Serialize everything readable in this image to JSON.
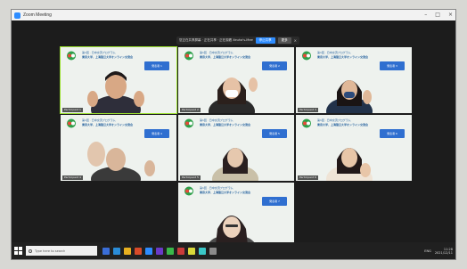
{
  "window": {
    "title": "Zoom Meeting",
    "controls": [
      "–",
      "□",
      "×"
    ]
  },
  "share_bar": {
    "text": "您正在共享屏幕 · 正在共享 · 正在观看 Xeuha's-Meeting 屏幕",
    "stop_label": "停止共享",
    "more_label": "更多"
  },
  "slide": {
    "line1": "第1回 · 日中交流プログラム",
    "line2": "東京大学、上海復旦大学オンライン交流会"
  },
  "participants": [
    {
      "card": "発表者 1",
      "label": "Participant 1",
      "active": true
    },
    {
      "card": "発表者 2",
      "label": "Participant 2",
      "active": false
    },
    {
      "card": "発表者 3",
      "label": "Participant 3",
      "active": false
    },
    {
      "card": "発表者 4",
      "label": "Participant 4",
      "active": false
    },
    {
      "card": "発表者 5",
      "label": "Participant 5",
      "active": false
    },
    {
      "card": "発表者 6",
      "label": "Participant 6",
      "active": false
    },
    {
      "card": "発表者 7",
      "label": "Participant 7",
      "active": false
    }
  ],
  "taskbar": {
    "search_placeholder": "Type here to search",
    "tray_text": "ENG",
    "clock_time": "11:28",
    "clock_date": "2021/12/11"
  },
  "colors": {
    "active_border": "#9be22d",
    "name_card": "#2f6fd0",
    "zoom_blue": "#2d8cff"
  }
}
